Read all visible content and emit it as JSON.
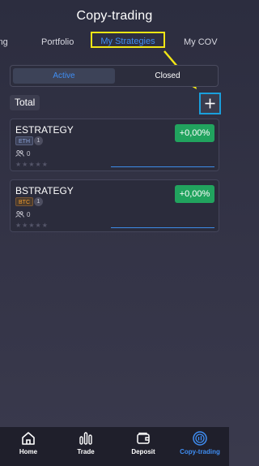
{
  "app": {
    "title": "Copy-trading"
  },
  "tabs": [
    {
      "label": "ting"
    },
    {
      "label": "Portfolio"
    },
    {
      "label": "My Strategies",
      "active": true
    },
    {
      "label": "My COV"
    }
  ],
  "segment": {
    "active_label": "Active",
    "closed_label": "Closed"
  },
  "summary": {
    "total_label": "Total"
  },
  "strategies": [
    {
      "name": "ESTRATEGY",
      "coin": "ETH",
      "count": "1",
      "followers": "0",
      "rating_stars": "★★★★★",
      "pnl": "+0,00%"
    },
    {
      "name": "BSTRATEGY",
      "coin": "BTC",
      "count": "1",
      "followers": "0",
      "rating_stars": "★★★★★",
      "pnl": "+0,00%"
    }
  ],
  "bottom_nav": [
    {
      "label": "Home",
      "icon": "home-icon"
    },
    {
      "label": "Trade",
      "icon": "trade-chart-icon"
    },
    {
      "label": "Deposit",
      "icon": "wallet-icon"
    },
    {
      "label": "Copy-trading",
      "icon": "copy-trading-icon",
      "active": true
    }
  ],
  "colors": {
    "accent": "#3f8ef3",
    "highlight_yellow": "#f2e615",
    "highlight_blue": "#1a9fdc",
    "positive": "#21a35e"
  }
}
